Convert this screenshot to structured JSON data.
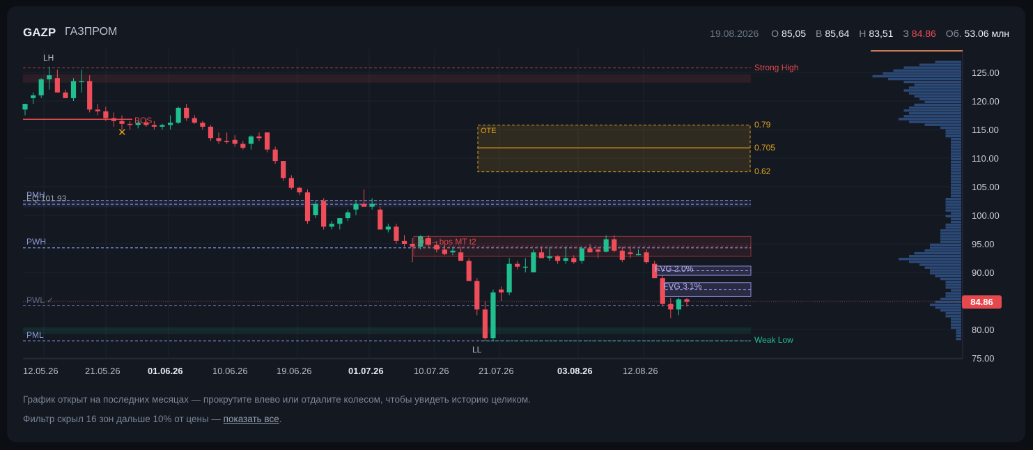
{
  "header": {
    "ticker": "GAZP",
    "company": "ГАЗПРОМ",
    "date": "19.08.2026",
    "open_label": "О",
    "open": "85,05",
    "high_label": "В",
    "high": "85,64",
    "low_label": "Н",
    "low": "83,51",
    "close_label": "З",
    "close": "84.86",
    "volume_label": "Об.",
    "volume": "53.06 млн"
  },
  "colors": {
    "up": "#1fbf8f",
    "down": "#f04d5a",
    "grid": "#1e2430",
    "level_blue": "#7f8dd6",
    "ote": "#e0a21e",
    "fvg": "#8f86d8",
    "strong_high": "#e5484d",
    "weak_low": "#1fbf8f",
    "volume_profile": "#2c4a78"
  },
  "annotations": {
    "lh": "LH",
    "ll": "LL",
    "bos": "BOS",
    "ote": "OTE",
    "fib_079": "0.79",
    "fib_0705": "0.705",
    "fib_062": "0.62",
    "pmh": "PMH",
    "eq": "EQ 101.93",
    "pwh": "PWH",
    "pwl": "PWL ✓",
    "pml": "PML",
    "ob": "OB – bos MT t2",
    "fvg1": "FVG 2.0%",
    "fvg2": "FVG 3.1%",
    "strong_high": "Strong High",
    "weak_low": "Weak Low",
    "price_tag": "84.86",
    "cross_marker": "x-marker"
  },
  "levels": {
    "strong_high": 125.8,
    "eq": 101.93,
    "pmh": 102.6,
    "pwh": 94.3,
    "pwl": 84.2,
    "pml": 78.0,
    "weak_low": 78.0,
    "ote_top": 115.8,
    "ote_mid": 111.8,
    "ote_bottom": 107.6,
    "bos": 116.8,
    "last_price": 84.86
  },
  "chart_data": {
    "type": "candlestick",
    "y_ticks": [
      "125.00",
      "120.00",
      "115.00",
      "110.00",
      "105.00",
      "100.00",
      "95.00",
      "90.00",
      "85.00",
      "80.00",
      "75.00"
    ],
    "x_ticks": [
      {
        "label": "12.05.26",
        "bold": false
      },
      {
        "label": "21.05.26",
        "bold": false
      },
      {
        "label": "01.06.26",
        "bold": true
      },
      {
        "label": "10.06.26",
        "bold": false
      },
      {
        "label": "19.06.26",
        "bold": false
      },
      {
        "label": "01.07.26",
        "bold": true
      },
      {
        "label": "10.07.26",
        "bold": false
      },
      {
        "label": "21.07.26",
        "bold": false
      },
      {
        "label": "03.08.26",
        "bold": true
      },
      {
        "label": "12.08.26",
        "bold": false
      }
    ],
    "ylim": [
      75,
      128
    ],
    "candles": [
      [
        118.5,
        119.5,
        117.5,
        119.5
      ],
      [
        120.5,
        121.5,
        119.5,
        121
      ],
      [
        121,
        124,
        120.5,
        123.8
      ],
      [
        123.8,
        126,
        122,
        124.5
      ],
      [
        124,
        125.5,
        121.5,
        121.5
      ],
      [
        121.5,
        122,
        120.5,
        120.5
      ],
      [
        120.5,
        124,
        120,
        123.5
      ],
      [
        123.5,
        125.5,
        121.5,
        123.5
      ],
      [
        123.5,
        124.5,
        118,
        118.5
      ],
      [
        118.5,
        119.5,
        117.5,
        118.2
      ],
      [
        118.2,
        119,
        116.5,
        117
      ],
      [
        117,
        118,
        115.5,
        116.5
      ],
      [
        116.5,
        117.5,
        115,
        116
      ],
      [
        116,
        116.5,
        115,
        115.8
      ],
      [
        115.8,
        116.5,
        115.2,
        116.2
      ],
      [
        116.2,
        116.8,
        115.5,
        115.8
      ],
      [
        115.8,
        116.5,
        115,
        115.5
      ],
      [
        115.5,
        116,
        115,
        115.8
      ],
      [
        115.8,
        117.5,
        115,
        116.2
      ],
      [
        116.2,
        119,
        116,
        118.8
      ],
      [
        118.8,
        119.5,
        116.5,
        117
      ],
      [
        117,
        117.5,
        116,
        116.2
      ],
      [
        116.2,
        116.5,
        115,
        115.5
      ],
      [
        115.5,
        115.8,
        113,
        113.5
      ],
      [
        113.5,
        114.5,
        112.5,
        113
      ],
      [
        113,
        114.5,
        112.5,
        112.8
      ],
      [
        113.2,
        114,
        112,
        112.5
      ],
      [
        112.5,
        113,
        111.5,
        111.8
      ],
      [
        112.5,
        114,
        111.5,
        113.8
      ],
      [
        113.8,
        114.5,
        113,
        113.5
      ],
      [
        114.5,
        114.5,
        111,
        111.5
      ],
      [
        111.5,
        112,
        109,
        109.5
      ],
      [
        109.5,
        109.5,
        106,
        106.5
      ],
      [
        106.5,
        107,
        104.5,
        104.8
      ],
      [
        104.8,
        105,
        103.5,
        104
      ],
      [
        104,
        104.5,
        98.5,
        99
      ],
      [
        100,
        102.5,
        99.5,
        102
      ],
      [
        102.5,
        103,
        97.5,
        98
      ],
      [
        98,
        99,
        97.5,
        98.5
      ],
      [
        98.5,
        99.5,
        97.5,
        99.5
      ],
      [
        99.5,
        101,
        99,
        100.5
      ],
      [
        101,
        102.5,
        100,
        102
      ],
      [
        102,
        104.5,
        101.5,
        101.5
      ],
      [
        101.5,
        103,
        101,
        102
      ],
      [
        101,
        101.5,
        97.5,
        97.5
      ],
      [
        97.5,
        98.5,
        97,
        98
      ],
      [
        98,
        98.5,
        95,
        95.5
      ],
      [
        95.5,
        96.5,
        94.5,
        95
      ],
      [
        95,
        96,
        91.8,
        94.5
      ],
      [
        94.5,
        96.5,
        94,
        96.3
      ],
      [
        96,
        96.5,
        94.5,
        94.8
      ],
      [
        94.8,
        95.5,
        93.5,
        94
      ],
      [
        94,
        95,
        93,
        93.2
      ],
      [
        93.5,
        94.5,
        93,
        93.8
      ],
      [
        93.5,
        94.5,
        92,
        92
      ],
      [
        92,
        92.5,
        88.5,
        88.5
      ],
      [
        88.5,
        89,
        82.5,
        83.5
      ],
      [
        83.5,
        85,
        78,
        78.5
      ],
      [
        78.5,
        87,
        78,
        86.5
      ],
      [
        87,
        87.5,
        85,
        86.5
      ],
      [
        86.5,
        92.5,
        86,
        91.5
      ],
      [
        91.5,
        92,
        90.5,
        91
      ],
      [
        91,
        92.5,
        90,
        91
      ],
      [
        90,
        94,
        90,
        93.5
      ],
      [
        93.5,
        94.5,
        92.5,
        92.5
      ],
      [
        92.5,
        94.5,
        92,
        92.8
      ],
      [
        92.8,
        93,
        91.5,
        92
      ],
      [
        92,
        94.5,
        91.5,
        92.5
      ],
      [
        92.5,
        93,
        91.5,
        91.8
      ],
      [
        92,
        94.5,
        91.5,
        94.2
      ],
      [
        94.2,
        95,
        93.5,
        93.5
      ],
      [
        94,
        94.5,
        92.5,
        93.6
      ],
      [
        93.6,
        96.5,
        93.5,
        95.8
      ],
      [
        95.8,
        96.5,
        93.5,
        93.8
      ],
      [
        93.8,
        94.5,
        91.8,
        92.2
      ],
      [
        93.5,
        94.5,
        92.5,
        93.2
      ],
      [
        93.2,
        94,
        93,
        93.2
      ],
      [
        93.5,
        94,
        91.5,
        91.8
      ],
      [
        91.5,
        92,
        89,
        89
      ],
      [
        89,
        89.5,
        84,
        84.5
      ],
      [
        84.5,
        85.5,
        82,
        83.5
      ],
      [
        83.5,
        85.5,
        82.5,
        85.3
      ],
      [
        85.3,
        85.5,
        84,
        84.86
      ]
    ],
    "volume_profile": [
      [
        126.8,
        5
      ],
      [
        126.3,
        8
      ],
      [
        125.8,
        11
      ],
      [
        125.3,
        13
      ],
      [
        124.8,
        15
      ],
      [
        124.3,
        17
      ],
      [
        123.8,
        14
      ],
      [
        123.3,
        11
      ],
      [
        122.8,
        9
      ],
      [
        122.3,
        10
      ],
      [
        121.8,
        11
      ],
      [
        121.3,
        10
      ],
      [
        120.8,
        9
      ],
      [
        120.3,
        8
      ],
      [
        119.8,
        7
      ],
      [
        119.3,
        9
      ],
      [
        118.8,
        10
      ],
      [
        118.3,
        11
      ],
      [
        117.8,
        10
      ],
      [
        117.3,
        11
      ],
      [
        116.8,
        12
      ],
      [
        116.3,
        10
      ],
      [
        115.8,
        7
      ],
      [
        115.3,
        4
      ],
      [
        114.8,
        3
      ],
      [
        114.3,
        3
      ],
      [
        113.8,
        3
      ],
      [
        113.3,
        2
      ],
      [
        112.8,
        2
      ],
      [
        112.3,
        2
      ],
      [
        111.8,
        2
      ],
      [
        111.3,
        2
      ],
      [
        110.8,
        2
      ],
      [
        110.3,
        2
      ],
      [
        109.8,
        2
      ],
      [
        109.3,
        2
      ],
      [
        108.8,
        2
      ],
      [
        108.3,
        2
      ],
      [
        107.8,
        2
      ],
      [
        107.3,
        2
      ],
      [
        106.8,
        2
      ],
      [
        106.3,
        2
      ],
      [
        105.8,
        2
      ],
      [
        105.3,
        2
      ],
      [
        104.8,
        2
      ],
      [
        104.3,
        2
      ],
      [
        103.8,
        2
      ],
      [
        103.3,
        2
      ],
      [
        102.8,
        3
      ],
      [
        102.3,
        3
      ],
      [
        101.8,
        3
      ],
      [
        101.3,
        3
      ],
      [
        100.8,
        3
      ],
      [
        100.3,
        2
      ],
      [
        99.8,
        3
      ],
      [
        99.3,
        2
      ],
      [
        98.8,
        2
      ],
      [
        98.3,
        3
      ],
      [
        97.8,
        3
      ],
      [
        97.3,
        4
      ],
      [
        96.8,
        4
      ],
      [
        96.3,
        4
      ],
      [
        95.8,
        4
      ],
      [
        95.3,
        4
      ],
      [
        94.8,
        6
      ],
      [
        94.3,
        6
      ],
      [
        93.8,
        7
      ],
      [
        93.3,
        9
      ],
      [
        92.8,
        10
      ],
      [
        92.3,
        12
      ],
      [
        91.8,
        10
      ],
      [
        91.3,
        8
      ],
      [
        90.8,
        7
      ],
      [
        90.3,
        6
      ],
      [
        89.8,
        6
      ],
      [
        89.3,
        5
      ],
      [
        88.8,
        4
      ],
      [
        88.3,
        3
      ],
      [
        87.8,
        3
      ],
      [
        87.3,
        3
      ],
      [
        86.8,
        2
      ],
      [
        86.3,
        3
      ],
      [
        85.8,
        3
      ],
      [
        85.3,
        4
      ],
      [
        84.8,
        5
      ],
      [
        84.3,
        6
      ],
      [
        83.8,
        5
      ],
      [
        83.3,
        4
      ],
      [
        82.8,
        3
      ],
      [
        82.3,
        3
      ],
      [
        81.8,
        2
      ],
      [
        81.3,
        2
      ],
      [
        80.8,
        2
      ],
      [
        80.3,
        2
      ],
      [
        79.8,
        1
      ],
      [
        79.3,
        1
      ],
      [
        78.8,
        1
      ],
      [
        78.3,
        1
      ]
    ]
  },
  "footer": {
    "line1": "График открыт на последних месяцах — прокрутите влево или отдалите колесом, чтобы увидеть историю целиком.",
    "line2_prefix": "Фильтр скрыл 16 зон дальше 10% от цены — ",
    "line2_link": "показать все",
    "line2_suffix": "."
  }
}
